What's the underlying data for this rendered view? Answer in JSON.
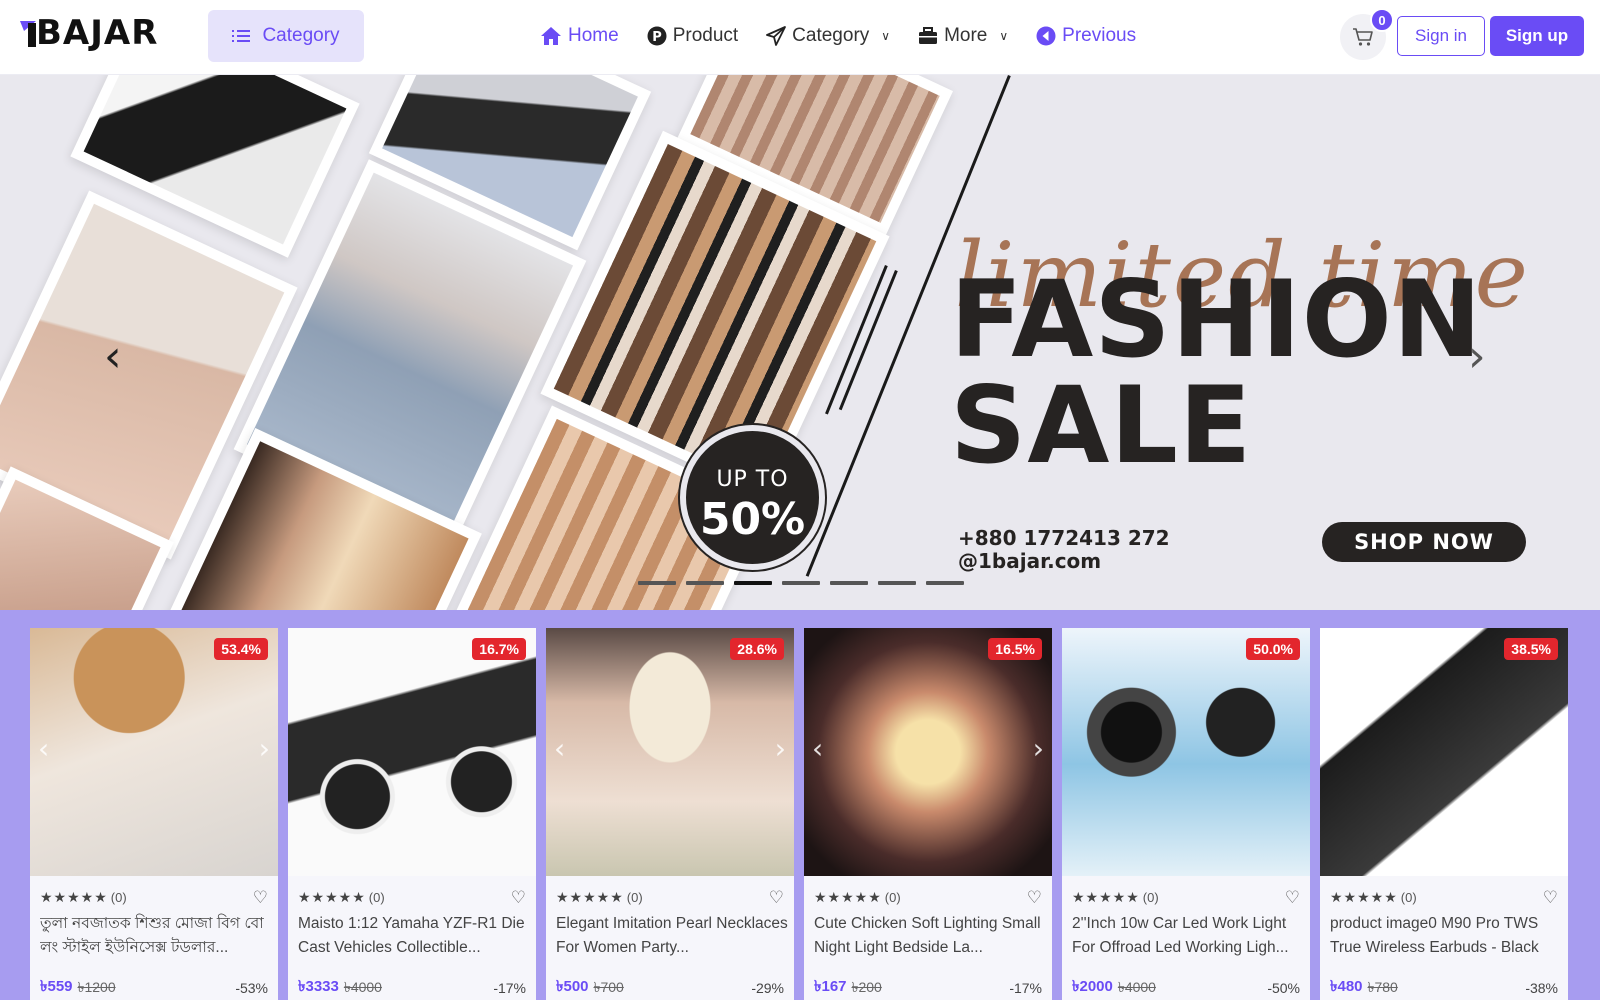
{
  "header": {
    "logo_text": "BAJAR",
    "category_button_label": "Category",
    "nav": [
      {
        "label": "Home",
        "icon": "home-icon"
      },
      {
        "label": "Product",
        "icon": "product-p-icon"
      },
      {
        "label": "Category",
        "icon": "paper-plane-icon"
      },
      {
        "label": "More",
        "icon": "briefcase-icon"
      },
      {
        "label": "Previous",
        "icon": "back-circle-icon"
      }
    ],
    "cart_count": "0",
    "signin_label": "Sign in",
    "signup_label": "Sign up"
  },
  "banner": {
    "script_text": "limited time",
    "headline_1": "FASHION",
    "headline_2": "SALE",
    "badge_line_1": "UP TO",
    "badge_line_2": "50%",
    "phone": "+880 1772413 272",
    "website": "@1bajar.com",
    "cta": "SHOP NOW",
    "slide_count": 7,
    "active_slide": 2
  },
  "products": [
    {
      "name": "তুলা নবজাতক শিশুর মোজা বিগ বো লং স্টাইল ইউনিসেক্স টডলার...",
      "discount_badge": "53.4%",
      "price": "৳559",
      "old_price": "৳1200",
      "percent_off": "-53%",
      "rating_count": "(0)",
      "stars": "★★★★★"
    },
    {
      "name": "Maisto 1:12 Yamaha YZF-R1 Die Cast Vehicles Collectible...",
      "discount_badge": "16.7%",
      "price": "৳3333",
      "old_price": "৳4000",
      "percent_off": "-17%",
      "rating_count": "(0)",
      "stars": "★★★★★"
    },
    {
      "name": "Elegant Imitation Pearl Necklaces For Women Party...",
      "discount_badge": "28.6%",
      "price": "৳500",
      "old_price": "৳700",
      "percent_off": "-29%",
      "rating_count": "(0)",
      "stars": "★★★★★"
    },
    {
      "name": "Cute Chicken Soft Lighting Small Night Light Bedside La...",
      "discount_badge": "16.5%",
      "price": "৳167",
      "old_price": "৳200",
      "percent_off": "-17%",
      "rating_count": "(0)",
      "stars": "★★★★★"
    },
    {
      "name": "2''Inch 10w Car Led Work Light For Offroad Led Working Ligh...",
      "discount_badge": "50.0%",
      "price": "৳2000",
      "old_price": "৳4000",
      "percent_off": "-50%",
      "rating_count": "(0)",
      "stars": "★★★★★"
    },
    {
      "name": "product image0 M90 Pro TWS True Wireless Earbuds - Black",
      "discount_badge": "38.5%",
      "price": "৳480",
      "old_price": "৳780",
      "percent_off": "-38%",
      "rating_count": "(0)",
      "stars": "★★★★★"
    }
  ],
  "colors": {
    "accent": "#6a4cf5",
    "section_bg": "#a79cf0",
    "badge_red": "#e3262d",
    "banner_bg": "#e9e8ee",
    "promo_dark": "#262322",
    "promo_brown": "#a77456"
  }
}
